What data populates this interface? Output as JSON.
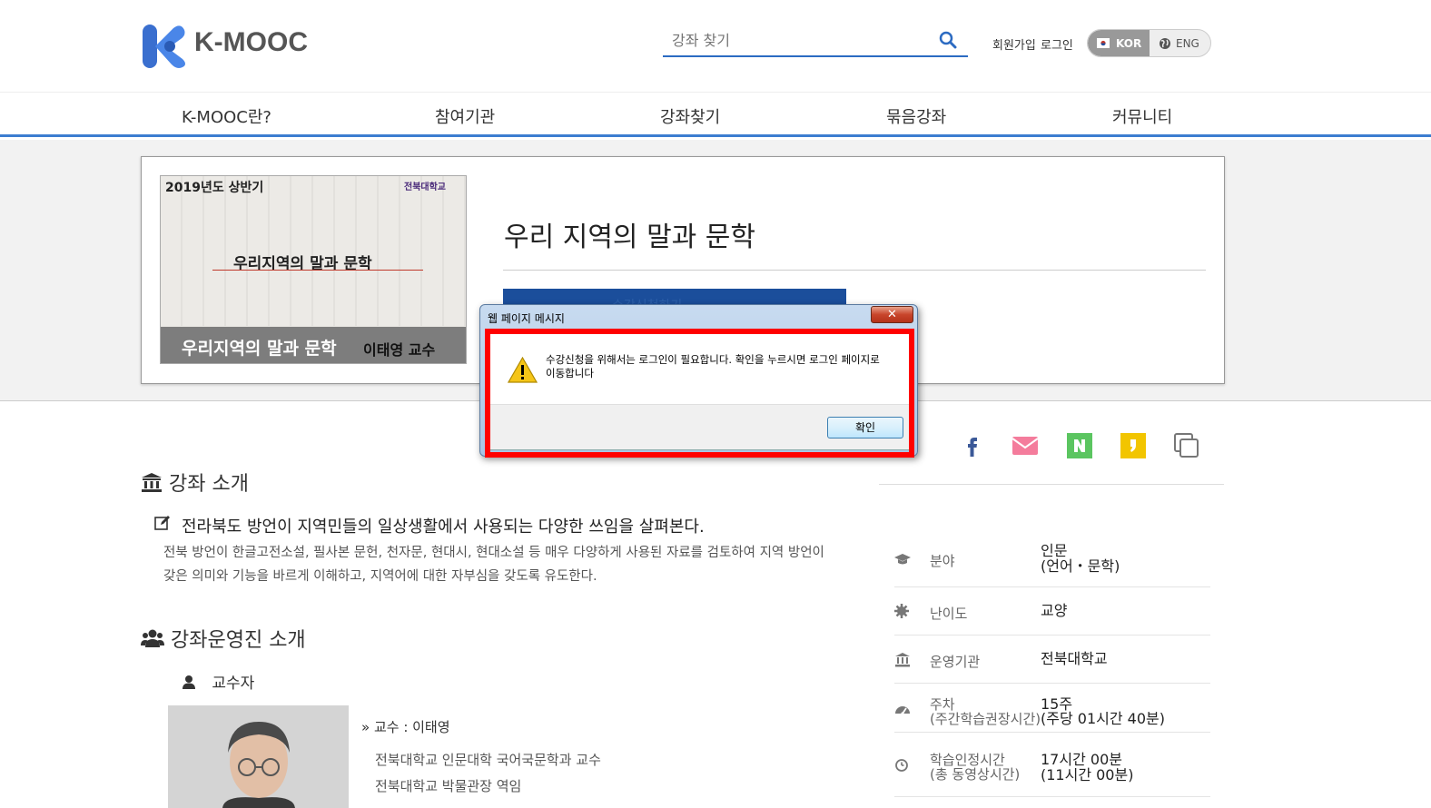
{
  "header": {
    "logo_text": "K-MOOC",
    "search_placeholder": "강좌 찾기",
    "join_label": "회원가입",
    "login_label": "로그인",
    "lang_kor": "KOR",
    "lang_eng": "ENG"
  },
  "nav": {
    "items": [
      "K-MOOC란?",
      "참여기관",
      "강좌찾기",
      "묶음강좌",
      "커뮤니티"
    ]
  },
  "course": {
    "thumb_semester": "2019년도 상반기",
    "thumb_univ": "전북대학교",
    "thumb_title": "우리지역의 말과 문학",
    "thumb_bar_title": "우리지역의 말과 문학",
    "thumb_bar_prof": "이태영 교수",
    "title": "우리 지역의 말과 문학",
    "enroll_label": "수강신청하기"
  },
  "intro": {
    "heading": "강좌 소개",
    "summary": "전라북도 방언이 지역민들의 일상생활에서 사용되는 다양한 쓰임을 살펴본다.",
    "body": "전북 방언이 한글고전소설, 필사본 문헌, 천자문, 현대시, 현대소설 등 매우 다양하게 사용된 자료를 검토하여 지역 방언이 갖은 의미와 기능을 바르게 이해하고, 지역어에 대한 자부심을 갖도록 유도한다."
  },
  "staff": {
    "heading": "강좌운영진 소개",
    "prof_label": "교수자",
    "prof_name": "» 교수 : 이태영",
    "career": [
      "전북대학교 인문대학 국어국문학과 교수",
      "전북대학교 박물관장 역임"
    ]
  },
  "info": {
    "rows": [
      {
        "label": "분야",
        "value": "인문",
        "value2": "(언어・문학)"
      },
      {
        "label": "난이도",
        "value": "교양"
      },
      {
        "label": "운영기관",
        "value": "전북대학교"
      },
      {
        "label": "주차",
        "label2": "(주간학습권장시간)",
        "value": "15주",
        "value2": "(주당 01시간 40분)"
      },
      {
        "label": "학습인정시간",
        "label2": "(총 동영상시간)",
        "value": "17시간 00분",
        "value2": "(11시간 00분)"
      }
    ]
  },
  "modal": {
    "title": "웹 페이지 메시지",
    "close_label": "✕",
    "message": "수강신청을 위해서는 로그인이 필요합니다. 확인을 누르시면 로그인 페이지로 이동합니다",
    "ok_label": "확인"
  },
  "colors": {
    "brand_blue": "#3c7dd0",
    "logo_blue": "#3a6fcf",
    "highlight": "#ff0000",
    "facebook": "#3b5998",
    "mail": "#f47c9c",
    "naver": "#5bc560",
    "kakao": "#f2c500"
  }
}
